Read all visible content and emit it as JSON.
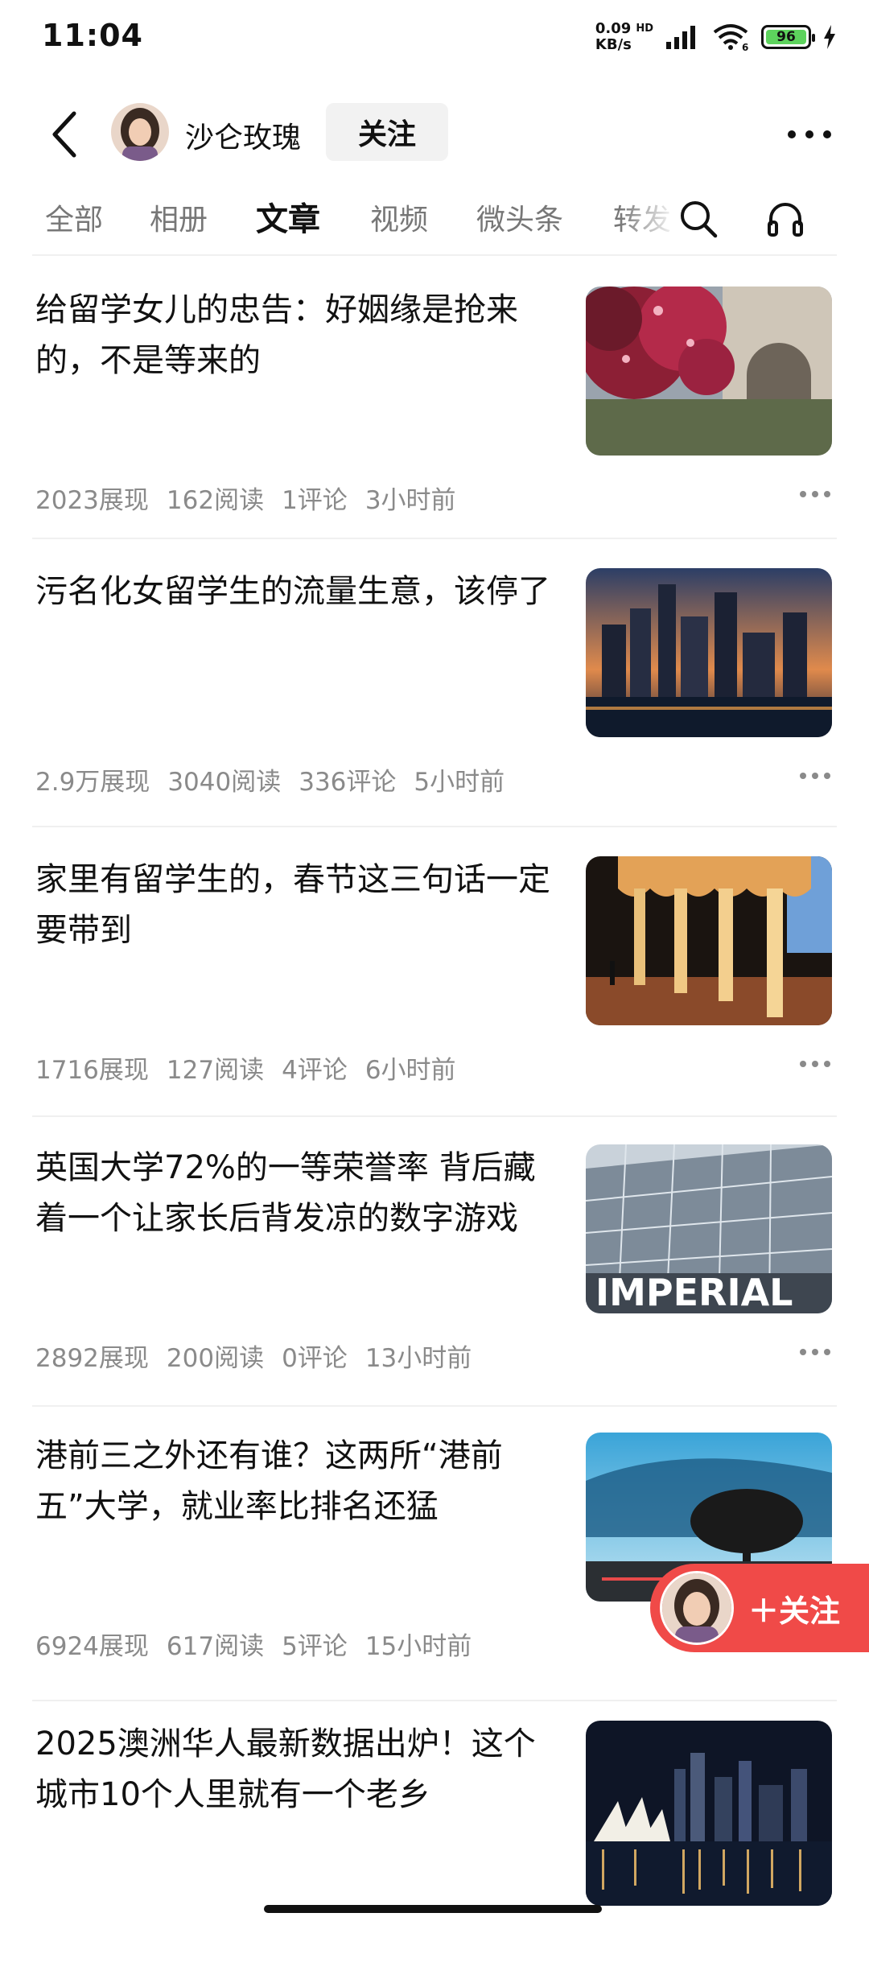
{
  "status_bar": {
    "time": "11:04",
    "net_speed_value": "0.09",
    "net_speed_unit": "KB/s",
    "hd_label": "HD",
    "battery": "96"
  },
  "header": {
    "author_name": "沙仑玫瑰",
    "follow_label": "关注"
  },
  "tabs": [
    {
      "label": "全部",
      "active": false
    },
    {
      "label": "相册",
      "active": false
    },
    {
      "label": "文章",
      "active": true
    },
    {
      "label": "视频",
      "active": false
    },
    {
      "label": "微头条",
      "active": false
    },
    {
      "label": "转发",
      "active": false
    }
  ],
  "articles": [
    {
      "title": "给留学女儿的忠告：好姻缘是抢来的，不是等来的",
      "views": "2023展现",
      "reads": "162阅读",
      "comments": "1评论",
      "time": "3小时前",
      "image": "flowering-tree-and-gothic-building"
    },
    {
      "title": "污名化女留学生的流量生意，该停了",
      "views": "2.9万展现",
      "reads": "3040阅读",
      "comments": "336评论",
      "time": "5小时前",
      "image": "city-skyline-at-dusk"
    },
    {
      "title": "家里有留学生的，春节这三句话一定要带到",
      "views": "1716展现",
      "reads": "127阅读",
      "comments": "4评论",
      "time": "6小时前",
      "image": "arched-colonnade"
    },
    {
      "title": "英国大学72%的一等荣誉率 背后藏着一个让家长后背发凉的数字游戏",
      "views": "2892展现",
      "reads": "200阅读",
      "comments": "0评论",
      "time": "13小时前",
      "image": "imperial-college-glass-building",
      "image_text": "IMPERIAL"
    },
    {
      "title": "港前三之外还有谁？这两所“港前五”大学，就业率比排名还猛",
      "views": "6924展现",
      "reads": "617阅读",
      "comments": "5评论",
      "time": "15小时前",
      "image": "modern-building-with-tree"
    },
    {
      "title": "2025澳洲华人最新数据出炉！这个城市10个人里就有一个老乡",
      "views": "",
      "reads": "",
      "comments": "",
      "time": "",
      "image": "sydney-opera-house-night"
    }
  ],
  "floating_follow": {
    "label": "＋关注"
  },
  "colors": {
    "accent_red": "#f04a48",
    "battery_green": "#5dd35d",
    "meta_gray": "#8a8a8a"
  }
}
